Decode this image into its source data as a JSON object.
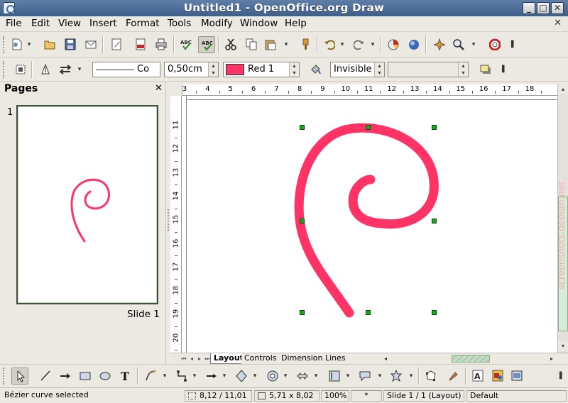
{
  "window": {
    "title": "Untitled1 - OpenOffice.org Draw",
    "controls": [
      "minimize",
      "maximize",
      "close"
    ]
  },
  "menu": [
    "File",
    "Edit",
    "View",
    "Insert",
    "Format",
    "Tools",
    "Modify",
    "Window",
    "Help"
  ],
  "line_toolbar": {
    "line_style": "Co",
    "line_width": "0,50cm",
    "line_color_name": "Red 1",
    "line_color_hex": "#ff3366",
    "area_style": "Invisible",
    "area_fill": ""
  },
  "pages_pane": {
    "title": "Pages",
    "page_number": "1",
    "slide_label": "Slide 1"
  },
  "rulers": {
    "horizontal": [
      "3",
      "4",
      "5",
      "6",
      "7",
      "8",
      "9",
      "10",
      "11",
      "12",
      "13",
      "14",
      "15",
      "16",
      "17",
      "18"
    ],
    "vertical": [
      "11",
      "12",
      "13",
      "14",
      "15",
      "16",
      "17",
      "18",
      "19",
      "20"
    ]
  },
  "layer_tabs": [
    "Layout",
    "Controls",
    "Dimension Lines"
  ],
  "status": {
    "selection": "Bézier curve selected",
    "position": "8,12 / 11,01",
    "size": "5,71 x 8,02",
    "zoom": "100%",
    "modified": "*",
    "slide": "Slide 1 / 1 (Layout)",
    "layout": "Default"
  },
  "watermark": "screenshots.debian.net",
  "colors": {
    "curve": "#ff3366",
    "handles": "#18a818",
    "titlebar": "#4a6b96"
  },
  "icons": {
    "standard": [
      "new-document-icon",
      "open-icon",
      "save-icon",
      "email-icon",
      "edit-file-icon",
      "export-pdf-icon",
      "print-icon",
      "spellcheck-icon",
      "autospellcheck-icon",
      "cut-icon",
      "copy-icon",
      "paste-icon",
      "clone-formatting-icon",
      "undo-icon",
      "redo-icon",
      "chart-icon",
      "3d-icon",
      "star-icon",
      "zoom-icon",
      "help-icon"
    ],
    "drawing": [
      "select-icon",
      "line-icon",
      "line-arrow-icon",
      "rectangle-icon",
      "ellipse-icon",
      "text-icon",
      "curve-icon",
      "connector-icon",
      "lines-arrows-icon",
      "basic-shapes-icon",
      "symbol-shapes-icon",
      "block-arrows-icon",
      "flowchart-icon",
      "callouts-icon",
      "stars-icon",
      "points-icon",
      "glue-points-icon",
      "fontwork-icon",
      "from-file-icon",
      "extrusion-icon"
    ]
  }
}
